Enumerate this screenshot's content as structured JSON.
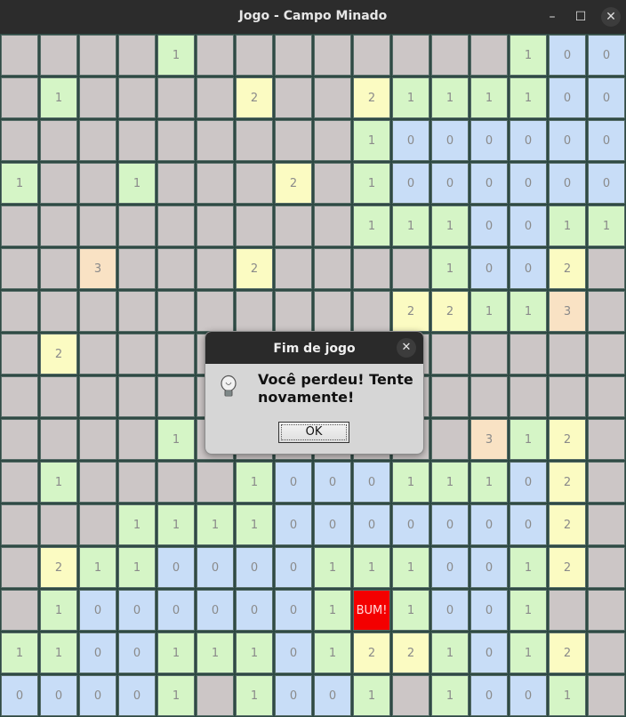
{
  "window": {
    "title": "Jogo - Campo Minado",
    "controls": {
      "minimize": "–",
      "maximize": "☐",
      "close": "✕"
    }
  },
  "board": {
    "rows": 16,
    "cols": 16,
    "cells": [
      [
        "",
        "",
        "",
        "",
        "1",
        "",
        "",
        "",
        "",
        "",
        "",
        "",
        "",
        "1",
        "0",
        "0"
      ],
      [
        "",
        "1",
        "",
        "",
        "",
        "",
        "2",
        "",
        "",
        "2",
        "1",
        "1",
        "1",
        "1",
        "0",
        "0"
      ],
      [
        "",
        "",
        "",
        "",
        "",
        "",
        "",
        "",
        "",
        "1",
        "0",
        "0",
        "0",
        "0",
        "0",
        "0"
      ],
      [
        "1",
        "",
        "",
        "1",
        "",
        "",
        "",
        "2",
        "",
        "1",
        "0",
        "0",
        "0",
        "0",
        "0",
        "0"
      ],
      [
        "",
        "",
        "",
        "",
        "",
        "",
        "",
        "",
        "",
        "1",
        "1",
        "1",
        "0",
        "0",
        "1",
        "1"
      ],
      [
        "",
        "",
        "3",
        "",
        "",
        "",
        "2",
        "",
        "",
        "",
        "",
        "1",
        "0",
        "0",
        "2",
        ""
      ],
      [
        "",
        "",
        "",
        "",
        "",
        "",
        "",
        "",
        "",
        "",
        "2",
        "2",
        "1",
        "1",
        "3",
        ""
      ],
      [
        "",
        "2",
        "",
        "",
        "",
        "",
        "",
        "",
        "",
        "",
        "",
        "",
        "",
        "",
        "",
        ""
      ],
      [
        "",
        "",
        "",
        "",
        "",
        "",
        "",
        "",
        "",
        "",
        "",
        "",
        "",
        "",
        "",
        ""
      ],
      [
        "",
        "",
        "",
        "",
        "1",
        "",
        "",
        "",
        "",
        "",
        "",
        "",
        "3",
        "1",
        "2",
        ""
      ],
      [
        "",
        "1",
        "",
        "",
        "",
        "",
        "1",
        "0",
        "0",
        "0",
        "1",
        "1",
        "1",
        "0",
        "2",
        ""
      ],
      [
        "",
        "",
        "",
        "1",
        "1",
        "1",
        "1",
        "0",
        "0",
        "0",
        "0",
        "0",
        "0",
        "0",
        "2",
        ""
      ],
      [
        "",
        "2",
        "1",
        "1",
        "0",
        "0",
        "0",
        "0",
        "1",
        "1",
        "1",
        "0",
        "0",
        "1",
        "2",
        ""
      ],
      [
        "",
        "1",
        "0",
        "0",
        "0",
        "0",
        "0",
        "0",
        "1",
        "BUM!",
        "1",
        "0",
        "0",
        "1",
        "",
        ""
      ],
      [
        "1",
        "1",
        "0",
        "0",
        "1",
        "1",
        "1",
        "0",
        "1",
        "2",
        "2",
        "1",
        "0",
        "1",
        "2",
        ""
      ],
      [
        "0",
        "0",
        "0",
        "0",
        "1",
        "",
        "1",
        "0",
        "0",
        "1",
        "",
        "1",
        "0",
        "0",
        "1",
        ""
      ]
    ],
    "colors": {
      "hidden": "#ccc6c6",
      "n0": "#c8ddf7",
      "n1": "#d5f5c6",
      "n2": "#fbfbc2",
      "n3": "#f9e2c4",
      "bum": "#f40000"
    }
  },
  "dialog": {
    "title": "Fim de jogo",
    "message": "Você perdeu! Tente novamente!",
    "ok_label": "OK",
    "close_glyph": "✕",
    "icon": "lightbulb-icon"
  }
}
